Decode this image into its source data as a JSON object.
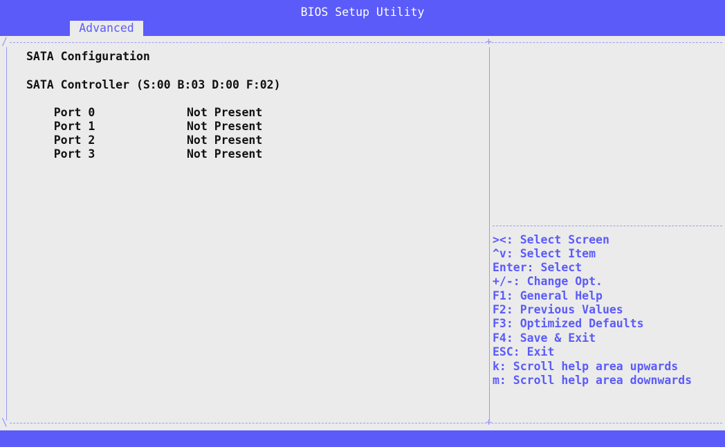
{
  "header": {
    "title": "BIOS Setup Utility",
    "tab": "Advanced"
  },
  "main": {
    "heading": "SATA Configuration",
    "controller": "SATA Controller (S:00 B:03 D:00 F:02)",
    "ports": [
      {
        "label": "Port 0",
        "value": "Not Present"
      },
      {
        "label": "Port 1",
        "value": "Not Present"
      },
      {
        "label": "Port 2",
        "value": "Not Present"
      },
      {
        "label": "Port 3",
        "value": "Not Present"
      }
    ]
  },
  "help": {
    "keys": [
      "><: Select Screen",
      "^v: Select Item",
      "Enter: Select",
      "+/-: Change Opt.",
      "F1: General Help",
      "F2: Previous Values",
      "F3: Optimized Defaults",
      "F4: Save & Exit",
      "ESC: Exit",
      "k: Scroll help area upwards",
      "m: Scroll help area downwards"
    ]
  },
  "colors": {
    "accent": "#5b5bf9",
    "background": "#ebebeb",
    "border": "#9a9af5"
  }
}
